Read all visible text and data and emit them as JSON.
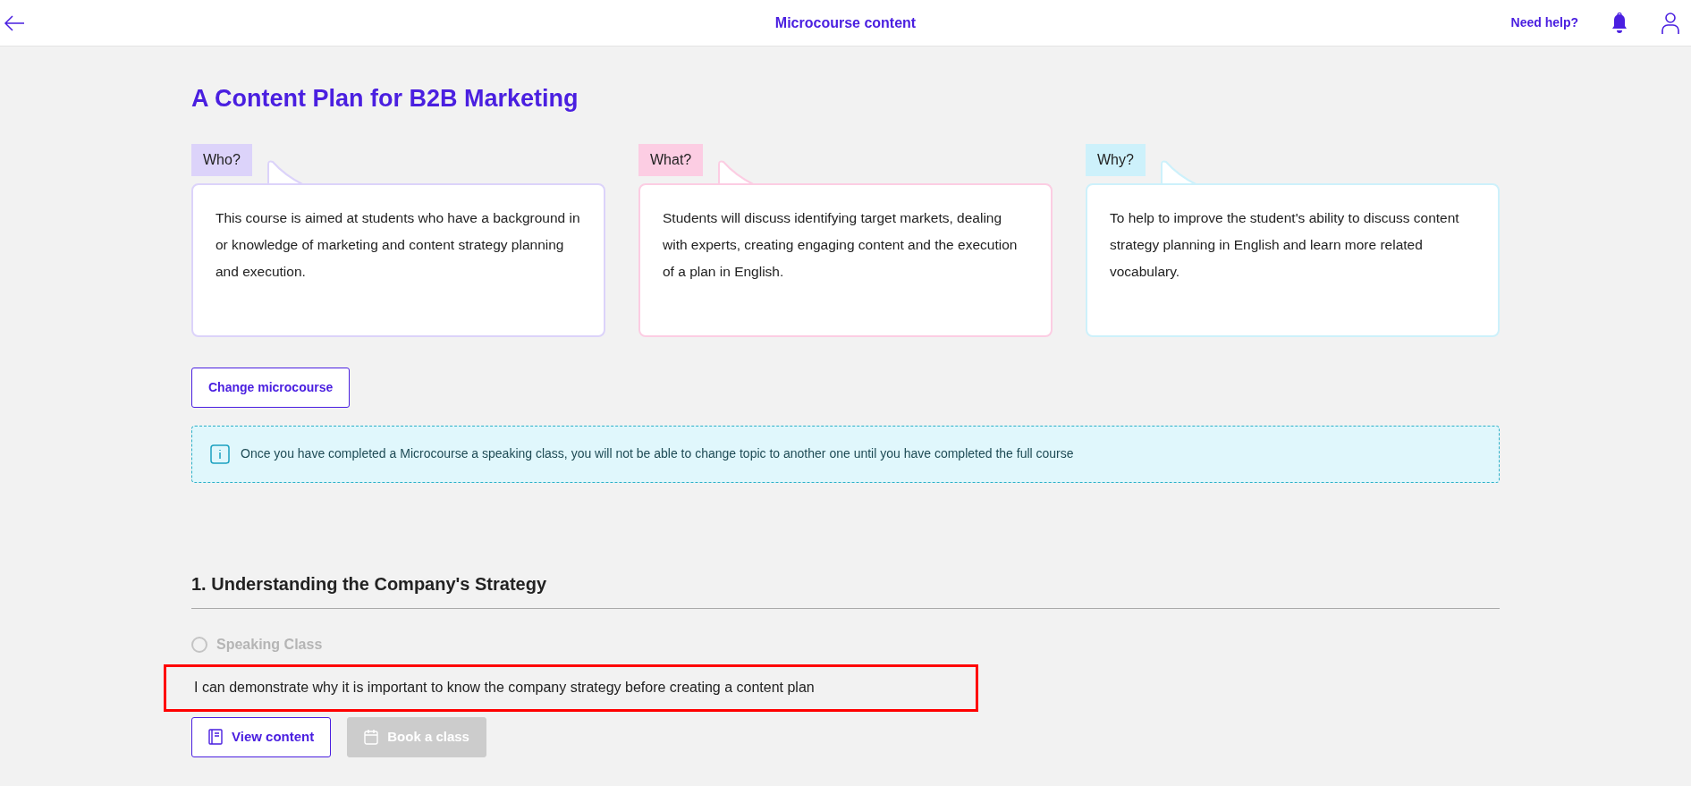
{
  "header": {
    "title": "Microcourse content",
    "help_link": "Need help?"
  },
  "course": {
    "title": "A Content Plan for B2B Marketing",
    "cards": [
      {
        "label": "Who?",
        "color": "#dcd3fa",
        "text": "This course is aimed at students who have a background in or knowledge of marketing and content strategy planning and execution."
      },
      {
        "label": "What?",
        "color": "#fccde3",
        "text": "Students will discuss identifying target markets, dealing with experts, creating engaging content and the execution of a plan in English."
      },
      {
        "label": "Why?",
        "color": "#cdf1fb",
        "text": "To help to improve the student's ability to discuss content strategy planning in English and learn more related vocabulary."
      }
    ],
    "change_button": "Change microcourse",
    "info": "Once you have completed a Microcourse a speaking class, you will not be able to change topic to another one until you have completed the full course"
  },
  "sections": [
    {
      "heading": "1. Understanding the Company's Strategy",
      "activity": {
        "label": "Speaking Class",
        "checked": false,
        "disabled": true
      },
      "objective": {
        "text": "I can demonstrate why it is important to know the company strategy before creating a content plan",
        "highlighted": true
      },
      "buttons": [
        {
          "kind": "view",
          "label": "View content",
          "disabled": false
        },
        {
          "kind": "book",
          "label": "Book a class",
          "disabled": true
        }
      ]
    }
  ]
}
